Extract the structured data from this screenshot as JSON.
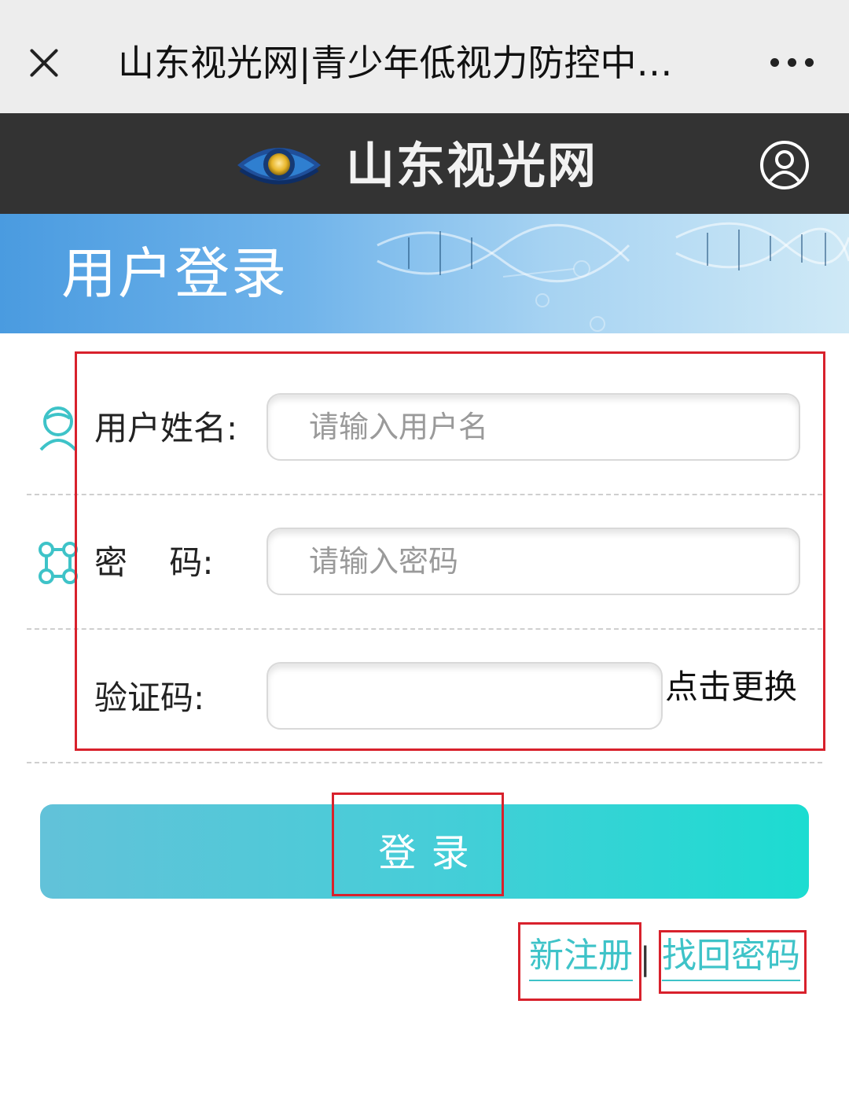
{
  "topbar": {
    "title": "山东视光网|青少年低视力防控中心|...",
    "close_icon": "close-icon",
    "more_icon": "more-dots-icon"
  },
  "header": {
    "brand_name": "山东视光网",
    "logo_icon": "eye-logo-icon",
    "user_icon": "user-circle-icon"
  },
  "banner": {
    "title": "用户登录"
  },
  "form": {
    "username": {
      "label": "用户姓名:",
      "placeholder": "请输入用户名",
      "value": "",
      "icon": "user-avatar-icon"
    },
    "password": {
      "label": "密    码:",
      "placeholder": "请输入密码",
      "value": "",
      "icon": "network-nodes-icon"
    },
    "captcha": {
      "label": "验证码:",
      "value": "",
      "refresh_label": "点击更换"
    }
  },
  "login": {
    "label": "登 录"
  },
  "links": {
    "register": "新注册",
    "separator": "|",
    "recover": "找回密码"
  },
  "colors": {
    "accent": "#3ec3c8",
    "highlight_box": "#d8212c",
    "header_bg": "#333333"
  }
}
